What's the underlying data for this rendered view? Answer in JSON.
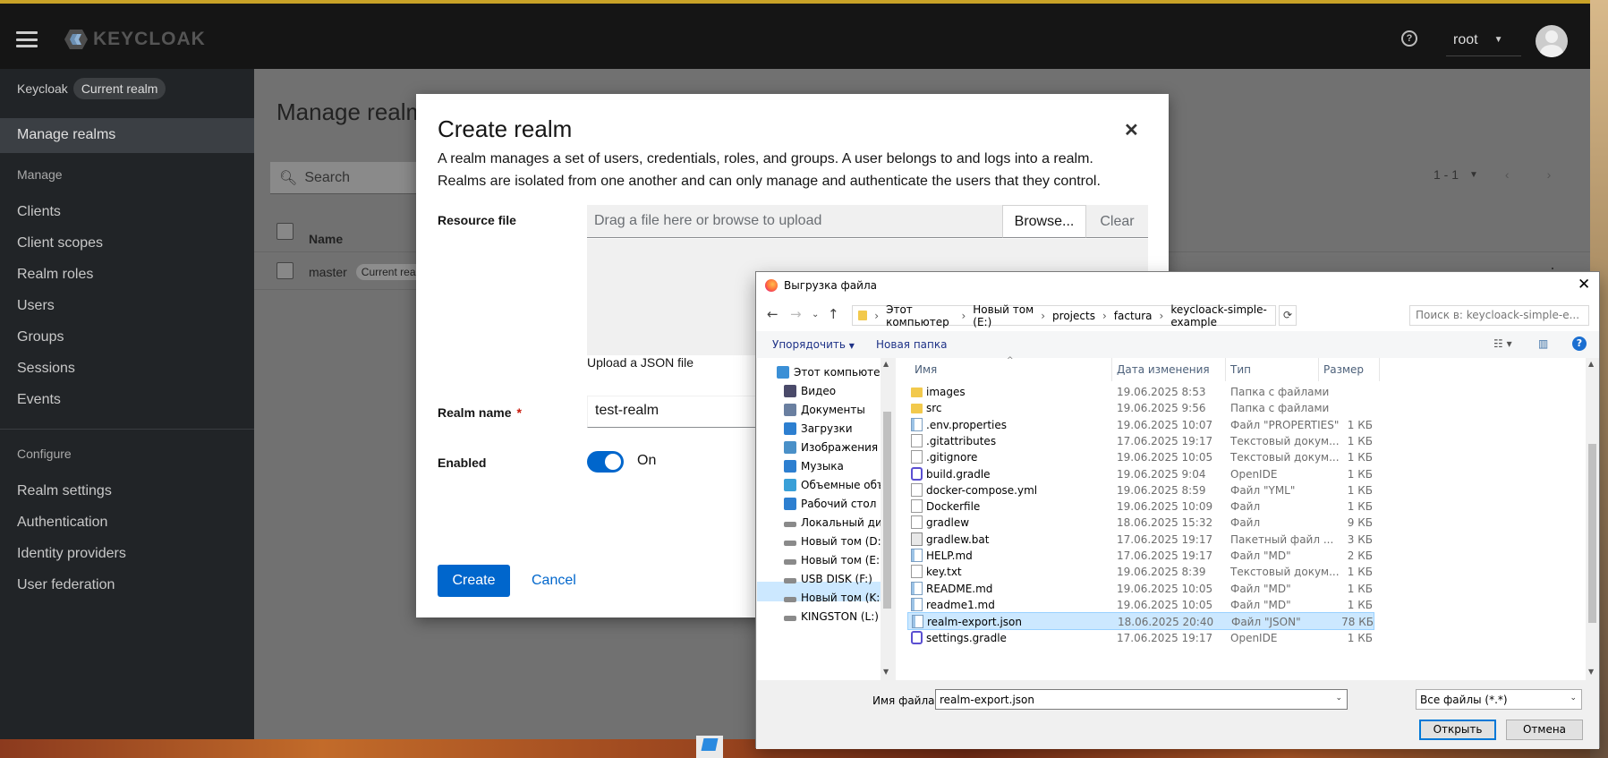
{
  "app": {
    "logo_text": "KEYCLOAK",
    "help_icon": "help-icon",
    "user_menu": "root"
  },
  "sidebar": {
    "realm_label": "Keycloak",
    "realm_chip": "Current realm",
    "active_item": "Manage realms",
    "manage_heading": "Manage",
    "manage_items": [
      "Clients",
      "Client scopes",
      "Realm roles",
      "Users",
      "Groups",
      "Sessions",
      "Events"
    ],
    "configure_heading": "Configure",
    "configure_items": [
      "Realm settings",
      "Authentication",
      "Identity providers",
      "User federation"
    ]
  },
  "main": {
    "title": "Manage realms",
    "search_placeholder": "Search",
    "pager": "1 - 1",
    "column_name": "Name",
    "row_name": "master",
    "row_chip": "Current realm"
  },
  "modal": {
    "title": "Create realm",
    "description": "A realm manages a set of users, credentials, roles, and groups. A user belongs to and logs into a realm. Realms are isolated from one another and can only manage and authenticate the users that they control.",
    "resource_label": "Resource file",
    "upload_placeholder": "Drag a file here or browse to upload",
    "browse_label": "Browse...",
    "clear_label": "Clear",
    "upload_help": "Upload a JSON file",
    "realm_name_label": "Realm name",
    "required_mark": "*",
    "realm_name_value": "test-realm",
    "enabled_label": "Enabled",
    "enabled_state": "On",
    "create_label": "Create",
    "cancel_label": "Cancel"
  },
  "file_dialog": {
    "title": "Выгрузка файла",
    "breadcrumb": [
      "Этот компьютер",
      "Новый том (E:)",
      "projects",
      "factura",
      "keycloack-simple-example"
    ],
    "search_placeholder": "Поиск в: keycloack-simple-e...",
    "organize_label": "Упорядочить",
    "new_folder_label": "Новая папка",
    "tree": [
      {
        "label": "Этот компьютер",
        "icon": "computer-icon",
        "color": "#3a8fd6"
      },
      {
        "label": "Видео",
        "icon": "video-icon",
        "color": "#4a4a6a"
      },
      {
        "label": "Документы",
        "icon": "documents-icon",
        "color": "#6a7fa0"
      },
      {
        "label": "Загрузки",
        "icon": "downloads-icon",
        "color": "#2d7fd0"
      },
      {
        "label": "Изображения",
        "icon": "pictures-icon",
        "color": "#4a90c8"
      },
      {
        "label": "Музыка",
        "icon": "music-icon",
        "color": "#2d7fd0"
      },
      {
        "label": "Объемные объ",
        "icon": "3d-objects-icon",
        "color": "#3aa0d8"
      },
      {
        "label": "Рабочий стол",
        "icon": "desktop-icon",
        "color": "#2d7fd0"
      },
      {
        "label": "Локальный дис",
        "icon": "drive-icon",
        "color": "#8a8a8a"
      },
      {
        "label": "Новый том (D:)",
        "icon": "drive-icon",
        "color": "#8a8a8a"
      },
      {
        "label": "Новый том (E:)",
        "icon": "drive-icon",
        "color": "#8a8a8a"
      },
      {
        "label": "USB DISK (F:)",
        "icon": "usb-drive-icon",
        "color": "#8a8a8a"
      },
      {
        "label": "Новый том (K:)",
        "icon": "drive-icon",
        "color": "#8a8a8a"
      },
      {
        "label": "KINGSTON (L:)",
        "icon": "usb-drive-icon",
        "color": "#8a8a8a"
      }
    ],
    "columns": {
      "name": "Имя",
      "date": "Дата изменения",
      "type": "Тип",
      "size": "Размер"
    },
    "files": [
      {
        "name": "images",
        "date": "19.06.2025 8:53",
        "type": "Папка с файлами",
        "size": "",
        "kind": "folder"
      },
      {
        "name": "src",
        "date": "19.06.2025 9:56",
        "type": "Папка с файлами",
        "size": "",
        "kind": "folder"
      },
      {
        "name": ".env.properties",
        "date": "19.06.2025 10:07",
        "type": "Файл \"PROPERTIES\"",
        "size": "1 КБ",
        "kind": "text"
      },
      {
        "name": ".gitattributes",
        "date": "17.06.2025 19:17",
        "type": "Текстовый докум...",
        "size": "1 КБ",
        "kind": "blank"
      },
      {
        "name": ".gitignore",
        "date": "19.06.2025 10:05",
        "type": "Текстовый докум...",
        "size": "1 КБ",
        "kind": "blank"
      },
      {
        "name": "build.gradle",
        "date": "19.06.2025 9:04",
        "type": "OpenIDE",
        "size": "1 КБ",
        "kind": "ide"
      },
      {
        "name": "docker-compose.yml",
        "date": "19.06.2025 8:59",
        "type": "Файл \"YML\"",
        "size": "1 КБ",
        "kind": "blank"
      },
      {
        "name": "Dockerfile",
        "date": "19.06.2025 10:09",
        "type": "Файл",
        "size": "1 КБ",
        "kind": "blank"
      },
      {
        "name": "gradlew",
        "date": "18.06.2025 15:32",
        "type": "Файл",
        "size": "9 КБ",
        "kind": "blank"
      },
      {
        "name": "gradlew.bat",
        "date": "17.06.2025 19:17",
        "type": "Пакетный файл ...",
        "size": "3 КБ",
        "kind": "gear"
      },
      {
        "name": "HELP.md",
        "date": "17.06.2025 19:17",
        "type": "Файл \"MD\"",
        "size": "2 КБ",
        "kind": "text"
      },
      {
        "name": "key.txt",
        "date": "19.06.2025 8:39",
        "type": "Текстовый докум...",
        "size": "1 КБ",
        "kind": "blank"
      },
      {
        "name": "README.md",
        "date": "19.06.2025 10:05",
        "type": "Файл \"MD\"",
        "size": "1 КБ",
        "kind": "text"
      },
      {
        "name": "readme1.md",
        "date": "19.06.2025 10:05",
        "type": "Файл \"MD\"",
        "size": "1 КБ",
        "kind": "text"
      },
      {
        "name": "realm-export.json",
        "date": "18.06.2025 20:40",
        "type": "Файл \"JSON\"",
        "size": "78 КБ",
        "kind": "text",
        "selected": true
      },
      {
        "name": "settings.gradle",
        "date": "17.06.2025 19:17",
        "type": "OpenIDE",
        "size": "1 КБ",
        "kind": "ide"
      }
    ],
    "filename_label": "Имя файла:",
    "filename_value": "realm-export.json",
    "filter_value": "Все файлы (*.*)",
    "open_label": "Открыть",
    "cancel_label": "Отмена"
  },
  "colors": {
    "accent": "#0066cc",
    "masthead": "#151515",
    "sidebar": "#212427",
    "selection": "#cce8ff"
  }
}
